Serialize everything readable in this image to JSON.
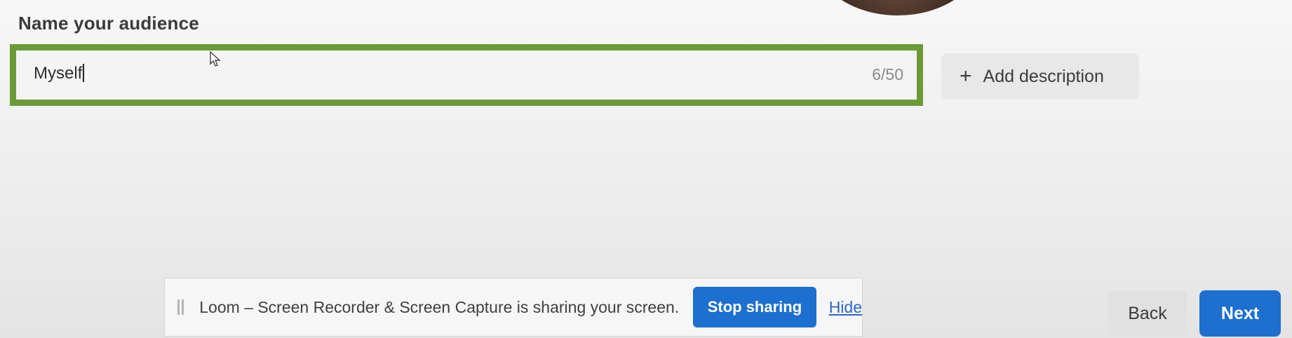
{
  "audience": {
    "heading": "Name your audience",
    "name_value": "Myself",
    "char_counter": "6/50",
    "add_description_label": "Add description"
  },
  "loom_bar": {
    "message": "Loom – Screen Recorder & Screen Capture is sharing your screen.",
    "stop_label": "Stop sharing",
    "hide_label": "Hide"
  },
  "footer": {
    "back_label": "Back",
    "next_label": "Next"
  },
  "colors": {
    "highlight": "#6a9b36",
    "primary": "#1d6fd0"
  },
  "icons": {
    "add": "plus-icon",
    "cursor": "cursor-icon",
    "drag": "drag-handle-icon"
  }
}
